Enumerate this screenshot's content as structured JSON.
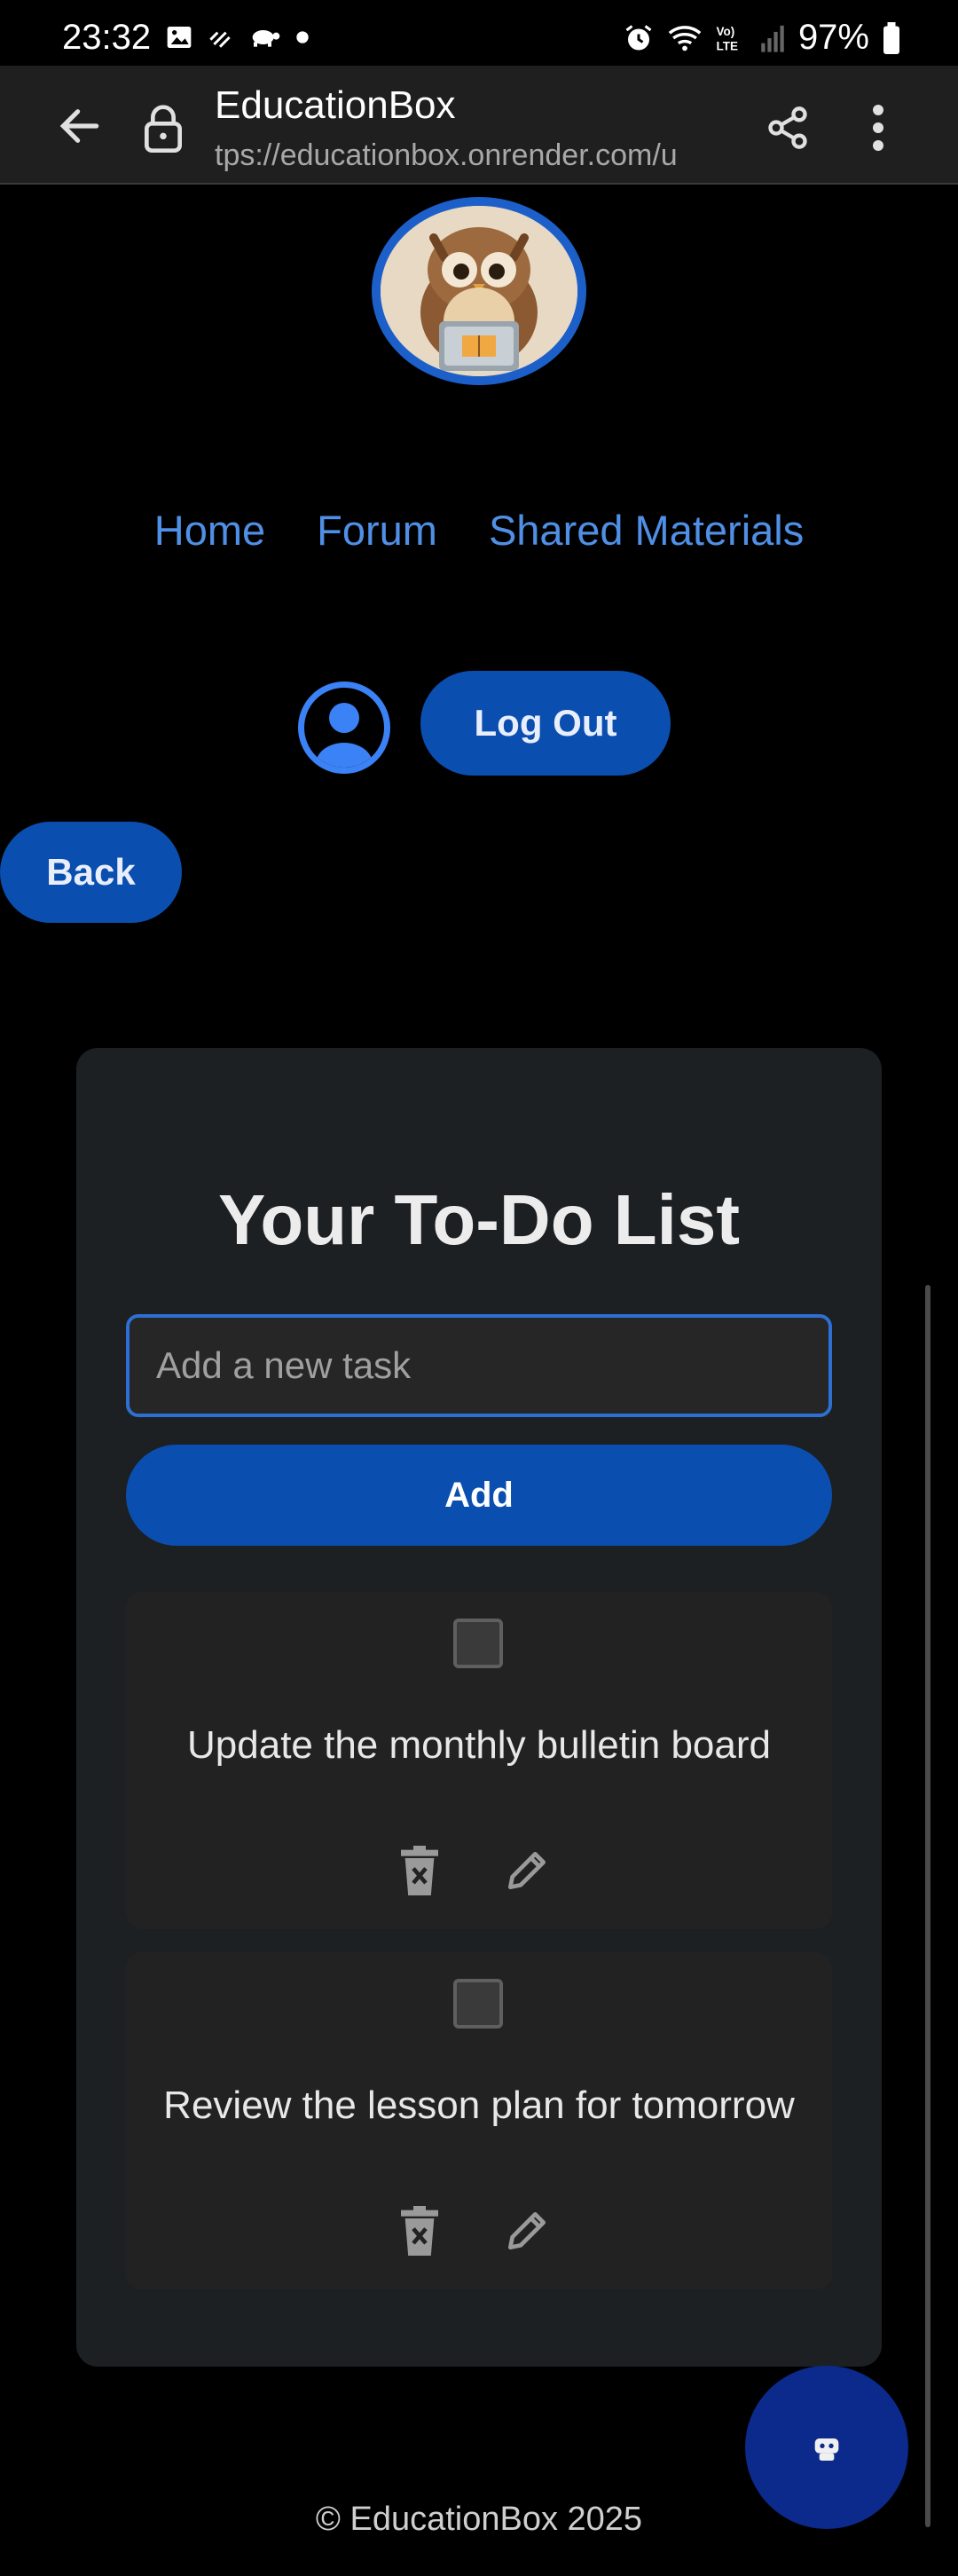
{
  "status_bar": {
    "time": "23:32",
    "battery": "97%",
    "left_icons": [
      "image-icon",
      "sensor-icon",
      "turtle-icon",
      "dot-icon"
    ],
    "right_icons": [
      "alarm-icon",
      "wifi-6-icon",
      "volte-icon",
      "signal-icon",
      "battery-icon"
    ]
  },
  "browser": {
    "title": "EducationBox",
    "url": "tps://educationbox.onrender.com/u"
  },
  "nav": {
    "items": [
      {
        "label": "Home"
      },
      {
        "label": "Forum"
      },
      {
        "label": "Shared Materials"
      }
    ]
  },
  "user": {
    "logout_label": "Log Out"
  },
  "page": {
    "back_label": "Back"
  },
  "todo": {
    "title": "Your To-Do List",
    "input_placeholder": "Add a new task",
    "add_label": "Add",
    "tasks": [
      {
        "text": "Update the monthly bulletin board",
        "done": false
      },
      {
        "text": "Review the lesson plan for tomorrow",
        "done": false
      }
    ]
  },
  "footer": {
    "text": "© EducationBox 2025"
  },
  "colors": {
    "accent": "#0a4fb0",
    "link": "#4f8fe5",
    "card_bg": "#1c2023",
    "fab": "#0b2a8c"
  }
}
